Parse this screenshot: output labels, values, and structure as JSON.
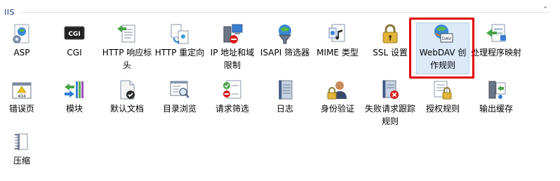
{
  "group": {
    "title": "IIS"
  },
  "items": [
    {
      "label": "ASP",
      "icon": "asp-icon"
    },
    {
      "label": "CGI",
      "icon": "cgi-icon"
    },
    {
      "label": "HTTP 响应标头",
      "icon": "http-headers-icon"
    },
    {
      "label": "HTTP 重定向",
      "icon": "http-redirect-icon"
    },
    {
      "label": "IP 地址和域限制",
      "icon": "ip-domain-restrictions-icon"
    },
    {
      "label": "ISAPI 筛选器",
      "icon": "isapi-filters-icon"
    },
    {
      "label": "MIME 类型",
      "icon": "mime-types-icon"
    },
    {
      "label": "SSL 设置",
      "icon": "ssl-settings-icon"
    },
    {
      "label": "WebDAV 创作规则",
      "icon": "webdav-icon",
      "selected": true
    },
    {
      "label": "处理程序映射",
      "icon": "handler-mappings-icon"
    },
    {
      "label": "错误页",
      "icon": "error-pages-icon"
    },
    {
      "label": "模块",
      "icon": "modules-icon"
    },
    {
      "label": "默认文档",
      "icon": "default-document-icon"
    },
    {
      "label": "目录浏览",
      "icon": "directory-browsing-icon"
    },
    {
      "label": "请求筛选",
      "icon": "request-filtering-icon"
    },
    {
      "label": "日志",
      "icon": "logging-icon"
    },
    {
      "label": "身份验证",
      "icon": "authentication-icon"
    },
    {
      "label": "失败请求跟踪规则",
      "icon": "failed-request-tracing-icon"
    },
    {
      "label": "授权规则",
      "icon": "authorization-rules-icon"
    },
    {
      "label": "输出缓存",
      "icon": "output-caching-icon"
    },
    {
      "label": "压缩",
      "icon": "compression-icon"
    }
  ],
  "webdav_badge": "DAV",
  "error_badge": "404",
  "cgi_badge": "CGI"
}
